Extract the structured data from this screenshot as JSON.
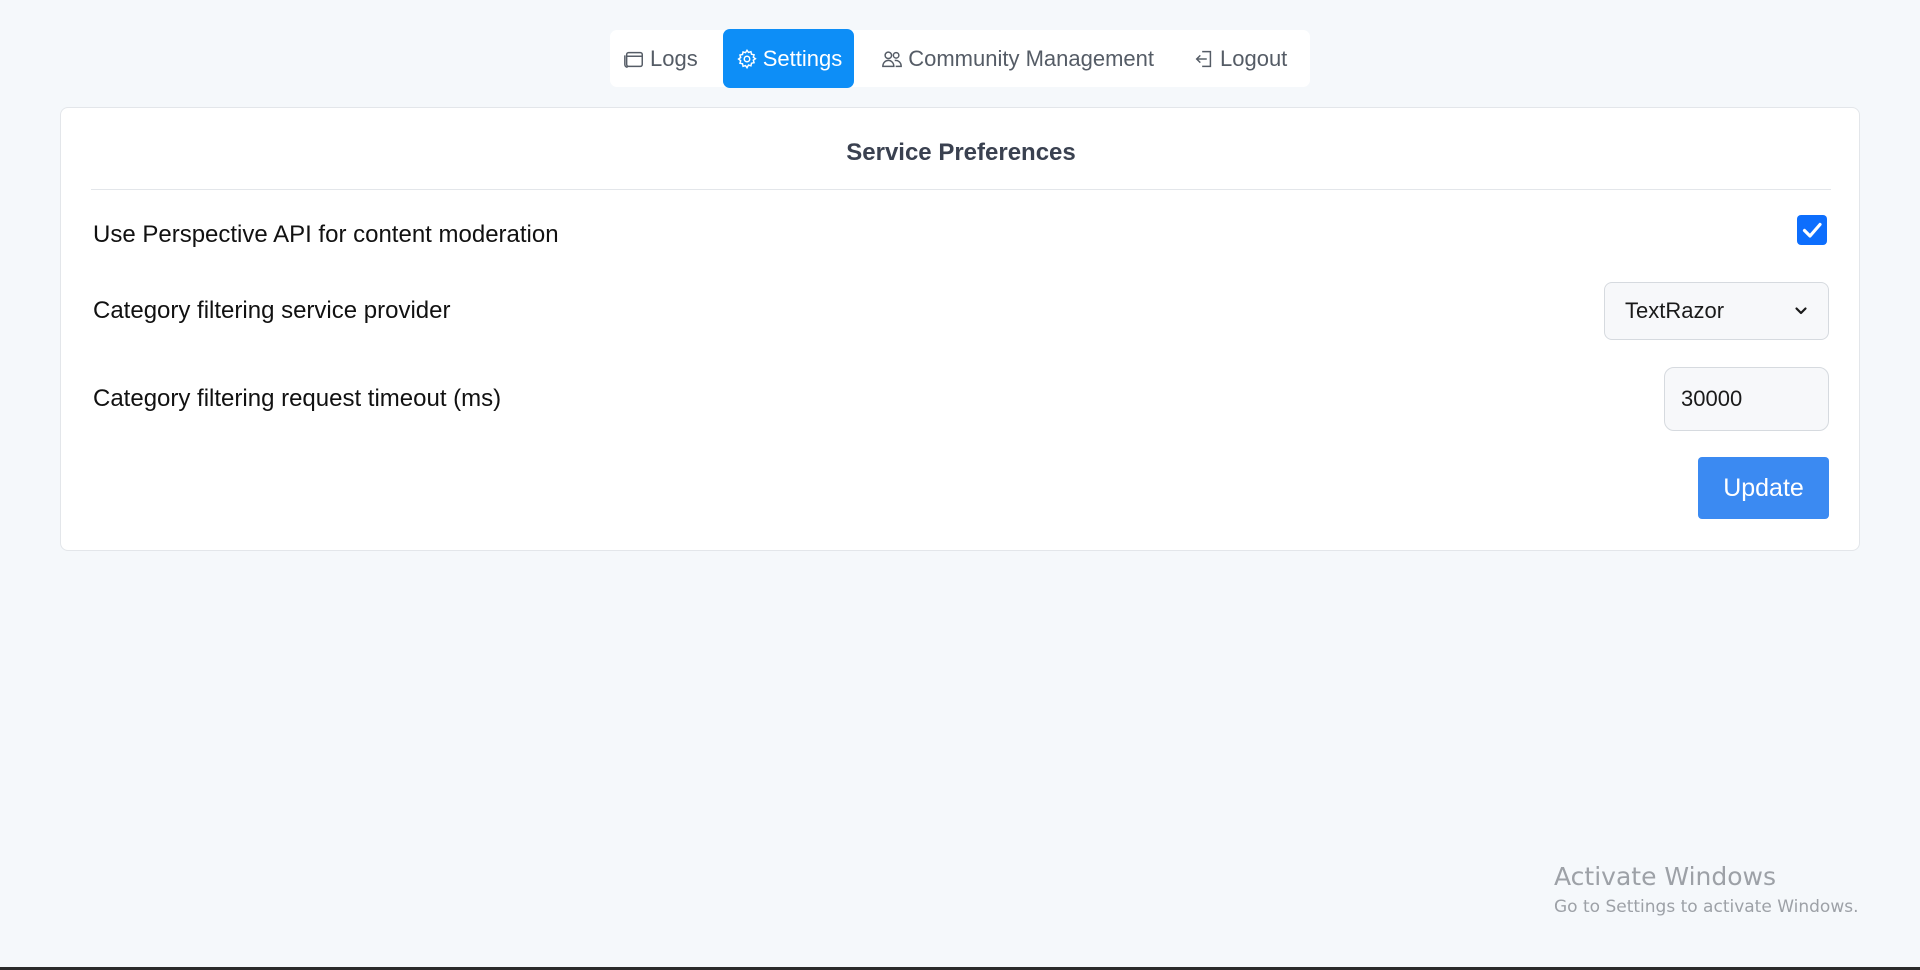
{
  "nav": {
    "items": [
      {
        "label": "Logs",
        "icon": "browser-window-icon",
        "active": false
      },
      {
        "label": "Settings",
        "icon": "gear-icon",
        "active": true
      },
      {
        "label": "Community Management",
        "icon": "people-icon",
        "active": false
      },
      {
        "label": "Logout",
        "icon": "logout-icon",
        "active": false
      }
    ],
    "active_color": "#0d8ef7"
  },
  "card": {
    "title": "Service Preferences",
    "perspective": {
      "label": "Use Perspective API for content moderation",
      "checked": true
    },
    "provider": {
      "label": "Category filtering service provider",
      "selected": "TextRazor"
    },
    "timeout": {
      "label": "Category filtering request timeout (ms)",
      "value": "30000"
    },
    "update_label": "Update",
    "accent_color": "#3b8af2"
  },
  "watermark": {
    "title": "Activate Windows",
    "subtitle": "Go to Settings to activate Windows."
  }
}
